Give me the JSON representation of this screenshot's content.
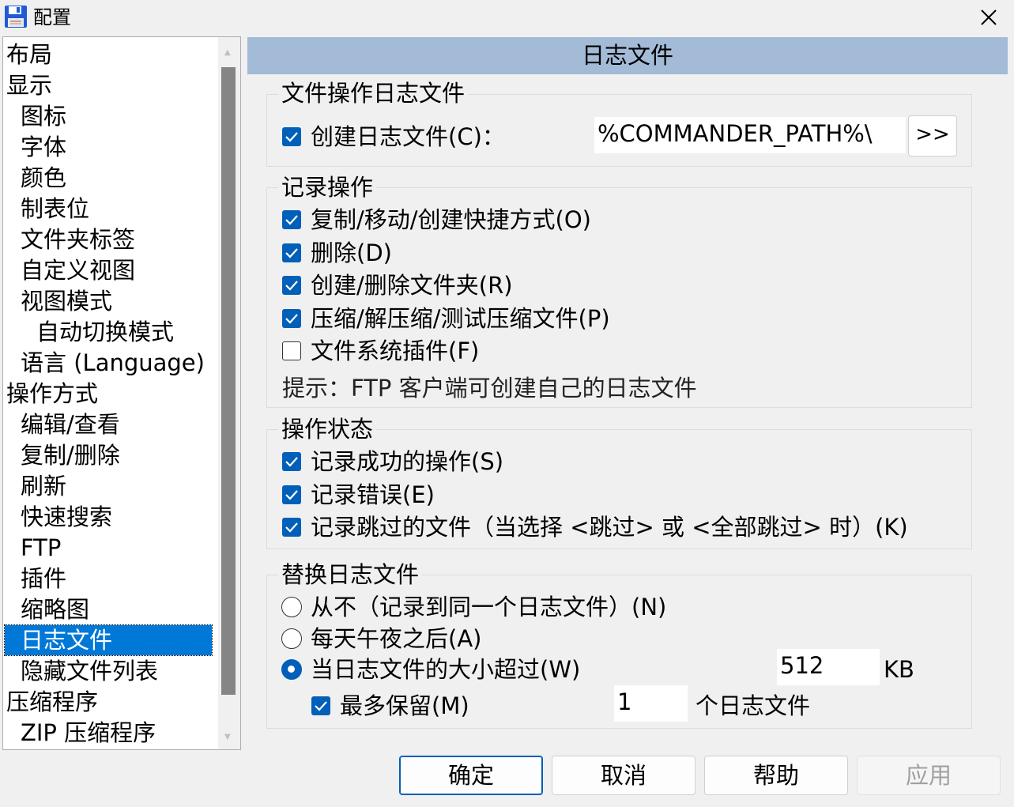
{
  "window": {
    "title": "配置",
    "icon": "floppy-disk-icon",
    "close_icon": "close-icon"
  },
  "tree": {
    "items": [
      {
        "label": "布局",
        "level": 0
      },
      {
        "label": "显示",
        "level": 0
      },
      {
        "label": "图标",
        "level": 1
      },
      {
        "label": "字体",
        "level": 1
      },
      {
        "label": "颜色",
        "level": 1
      },
      {
        "label": "制表位",
        "level": 1
      },
      {
        "label": "文件夹标签",
        "level": 1
      },
      {
        "label": "自定义视图",
        "level": 1
      },
      {
        "label": "视图模式",
        "level": 1
      },
      {
        "label": "自动切换模式",
        "level": 2
      },
      {
        "label": "语言 (Language)",
        "level": 1
      },
      {
        "label": "操作方式",
        "level": 0
      },
      {
        "label": "编辑/查看",
        "level": 1
      },
      {
        "label": "复制/删除",
        "level": 1
      },
      {
        "label": "刷新",
        "level": 1
      },
      {
        "label": "快速搜索",
        "level": 1
      },
      {
        "label": "FTP",
        "level": 1
      },
      {
        "label": "插件",
        "level": 1
      },
      {
        "label": "缩略图",
        "level": 1
      },
      {
        "label": "日志文件",
        "level": 1,
        "selected": true
      },
      {
        "label": "隐藏文件列表",
        "level": 1
      },
      {
        "label": "压缩程序",
        "level": 0
      },
      {
        "label": "ZIP 压缩程序",
        "level": 1
      }
    ]
  },
  "header": {
    "title": "日志文件"
  },
  "file_log": {
    "title": "文件操作日志文件",
    "create_log": {
      "label": "创建日志文件(C)：",
      "checked": true
    },
    "path_value": "%COMMANDER_PATH%\\",
    "browse_label": ">>"
  },
  "record_ops": {
    "title": "记录操作",
    "items": [
      {
        "label": "复制/移动/创建快捷方式(O)",
        "checked": true
      },
      {
        "label": "删除(D)",
        "checked": true
      },
      {
        "label": "创建/删除文件夹(R)",
        "checked": true
      },
      {
        "label": "压缩/解压缩/测试压缩文件(P)",
        "checked": true
      },
      {
        "label": "文件系统插件(F)",
        "checked": false
      }
    ],
    "hint": "提示：FTP 客户端可创建自己的日志文件"
  },
  "op_status": {
    "title": "操作状态",
    "items": [
      {
        "label": "记录成功的操作(S)",
        "checked": true
      },
      {
        "label": "记录错误(E)",
        "checked": true
      },
      {
        "label": "记录跳过的文件（当选择 <跳过> 或 <全部跳过> 时）(K)",
        "checked": true
      }
    ]
  },
  "replace_log": {
    "title": "替换日志文件",
    "options": [
      {
        "label": "从不（记录到同一个日志文件）(N)",
        "selected": false
      },
      {
        "label": "每天午夜之后(A)",
        "selected": false
      },
      {
        "label": "当日志文件的大小超过(W)",
        "selected": true
      }
    ],
    "size_value": "512",
    "size_unit": "KB",
    "keep_max": {
      "label": "最多保留(M)",
      "checked": true
    },
    "keep_value": "1",
    "keep_unit": "个日志文件"
  },
  "buttons": {
    "ok": "确定",
    "cancel": "取消",
    "help": "帮助",
    "apply": "应用"
  },
  "colors": {
    "accent": "#005fb8",
    "selection": "#0078d7",
    "header_bg": "#a3bbd6"
  }
}
